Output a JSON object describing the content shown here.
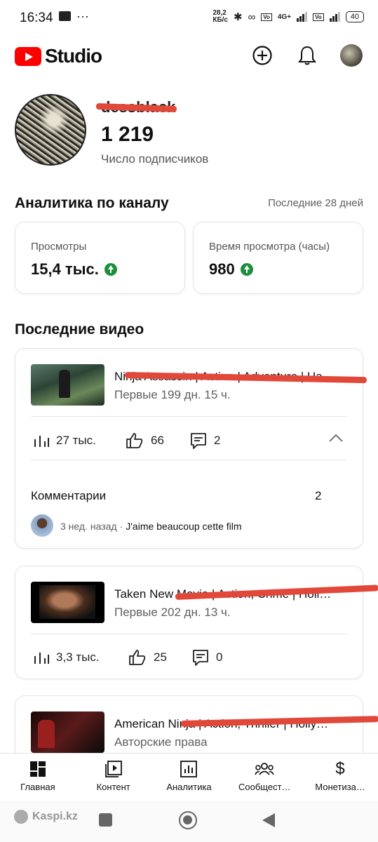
{
  "status_bar": {
    "time": "16:34",
    "speed_top": "28,2",
    "speed_unit": "КБ/с",
    "network": "4G+",
    "battery": "40"
  },
  "header": {
    "logo_text": "Studio",
    "create_icon": "add-circle-icon",
    "notifications_icon": "bell-icon"
  },
  "channel": {
    "name": "dessblack",
    "subscribers": "1 219",
    "subscribers_label": "Число подписчиков"
  },
  "analytics": {
    "title": "Аналитика по каналу",
    "period": "Последние 28 дней",
    "views_label": "Просмотры",
    "views_value": "15,4 тыс.",
    "watch_label": "Время просмотра (часы)",
    "watch_value": "980",
    "trend_color": "#1e8e3e"
  },
  "recent": {
    "title": "Последние видео",
    "videos": [
      {
        "title": "Ninja Assassin | Action | Adventure | Ha",
        "subtitle": "Первые 199 дн. 15 ч.",
        "views": "27 тыс.",
        "likes": "66",
        "comments": "2",
        "comments_section": {
          "label": "Комментарии",
          "count": "2",
          "time": "3 нед. назад",
          "separator": "·",
          "text": "J'aime beaucoup cette film"
        }
      },
      {
        "title": "Taken New Movie | Action, Crime | Holl…",
        "subtitle": "Первые 202 дн. 13 ч.",
        "views": "3,3 тыс.",
        "likes": "25",
        "comments": "0"
      },
      {
        "title": "American Ninja | Action, Thriller | Holly…",
        "subtitle": "Авторские права"
      }
    ]
  },
  "bottom_nav": {
    "items": [
      {
        "label": "Главная",
        "icon": "dashboard-icon"
      },
      {
        "label": "Контент",
        "icon": "content-icon"
      },
      {
        "label": "Аналитика",
        "icon": "analytics-icon"
      },
      {
        "label": "Сообщест…",
        "icon": "community-icon"
      },
      {
        "label": "Монетиза…",
        "icon": "dollar-icon"
      }
    ]
  },
  "watermark": "Kaspi.kz",
  "accent": "#ff0000",
  "redaction_color": "#e2483a"
}
